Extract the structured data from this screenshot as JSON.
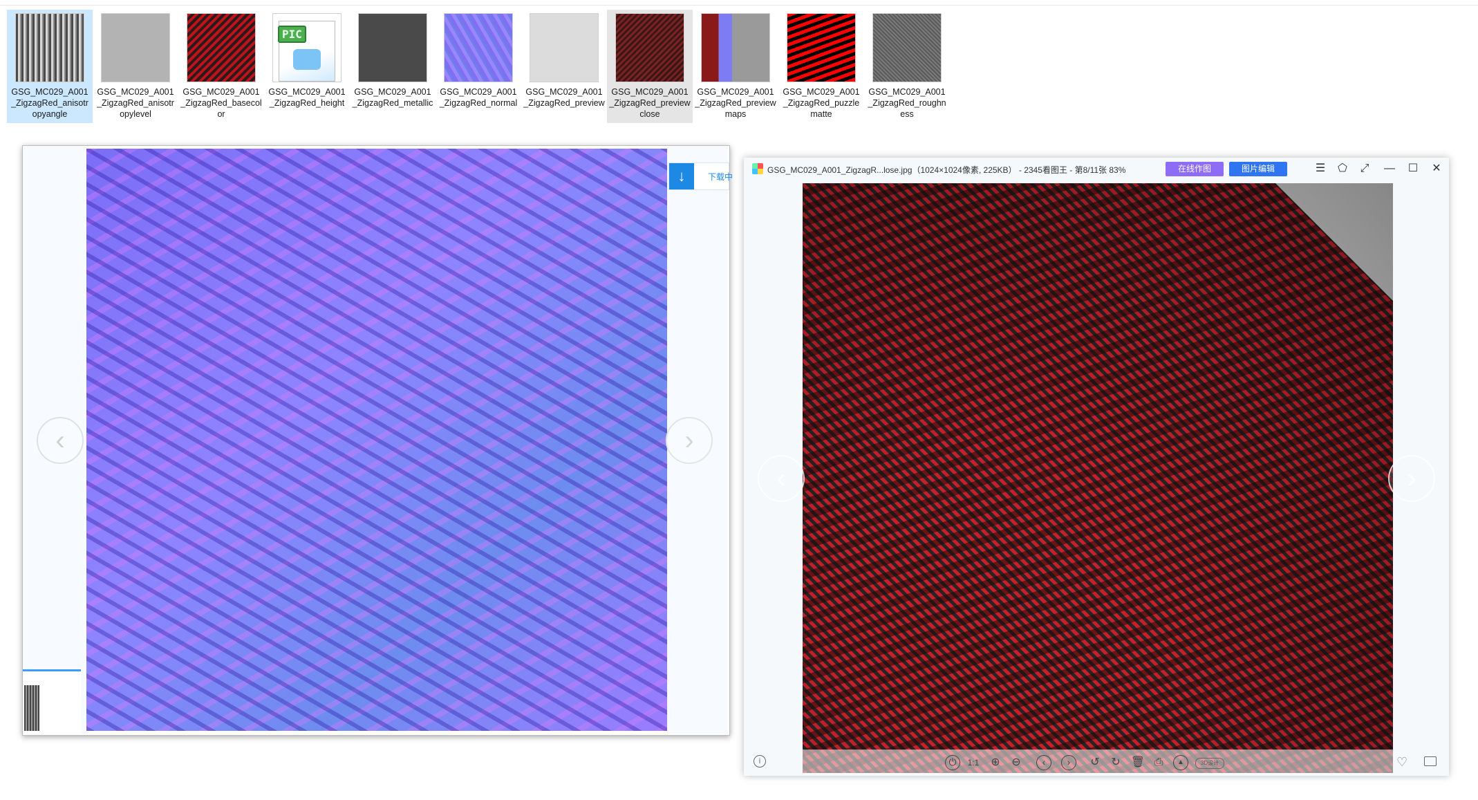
{
  "explorer": {
    "items": [
      {
        "name": "GSG_MC029_A001_ZigzagRed_anisotropyangle",
        "state": "selected",
        "thumb": "t-anisoangle"
      },
      {
        "name": "GSG_MC029_A001_ZigzagRed_anisotropylevel",
        "state": "",
        "thumb": "t-anisolevel"
      },
      {
        "name": "GSG_MC029_A001_ZigzagRed_basecolor",
        "state": "",
        "thumb": "t-basecolor"
      },
      {
        "name": "GSG_MC029_A001_ZigzagRed_height",
        "state": "",
        "thumb": "t-height",
        "icon": "pic-file-icon",
        "icon_text": "PIC"
      },
      {
        "name": "GSG_MC029_A001_ZigzagRed_metallic",
        "state": "",
        "thumb": "t-metallic"
      },
      {
        "name": "GSG_MC029_A001_ZigzagRed_normal",
        "state": "",
        "thumb": "t-normal"
      },
      {
        "name": "GSG_MC029_A001_ZigzagRed_preview",
        "state": "",
        "thumb": "t-preview"
      },
      {
        "name": "GSG_MC029_A001_ZigzagRed_previewclose",
        "state": "hover",
        "thumb": "t-close"
      },
      {
        "name": "GSG_MC029_A001_ZigzagRed_previewmaps",
        "state": "",
        "thumb": "t-maps"
      },
      {
        "name": "GSG_MC029_A001_ZigzagRed_puzzlematte",
        "state": "",
        "thumb": "t-puzzle"
      },
      {
        "name": "GSG_MC029_A001_ZigzagRed_roughness",
        "state": "",
        "thumb": "t-rough"
      }
    ]
  },
  "preview_window": {
    "download_label": "下载中",
    "download_icon": "down-arrow-icon",
    "prev_glyph": "‹",
    "next_glyph": "›"
  },
  "viewer": {
    "title": "GSG_MC029_A001_ZigzagR...lose.jpg（1024×1024像素, 225KB） - 2345看图王 - 第8/11张 83%",
    "btn_online": "在线作图",
    "btn_edit": "图片编辑",
    "window_controls": [
      "☰",
      "⬠",
      "⤢",
      "—",
      "☐",
      "✕"
    ],
    "prev_glyph": "‹",
    "next_glyph": "›",
    "toolbar": {
      "one_to_one": "1:1",
      "badge_3d": "3D设计"
    },
    "colors": {
      "online_button": "#8e6cf5",
      "edit_button": "#2f74f0",
      "accent": "#1e88e5"
    }
  }
}
